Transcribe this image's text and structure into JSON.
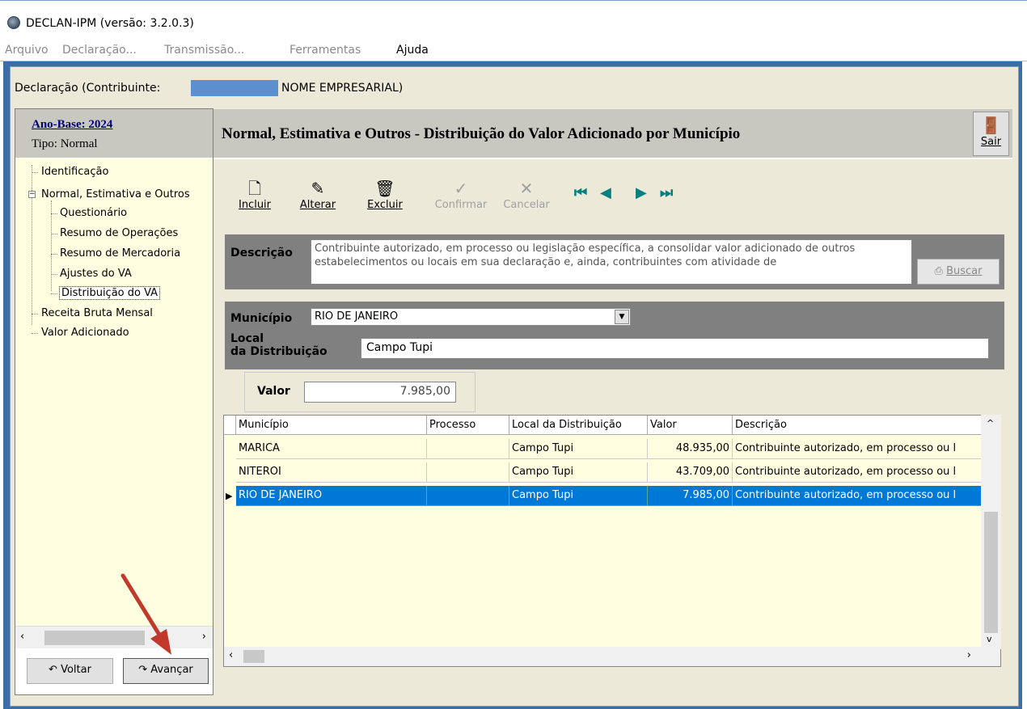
{
  "window": {
    "title": "DECLAN-IPM (versão: 3.2.0.3)"
  },
  "menu": {
    "items": [
      {
        "label": "Arquivo",
        "enabled": false
      },
      {
        "label": "Declaração...",
        "enabled": false
      },
      {
        "label": "Transmissão...",
        "enabled": false
      },
      {
        "label": "Ferramentas",
        "enabled": false
      },
      {
        "label": "Ajuda",
        "enabled": true
      }
    ]
  },
  "header": {
    "declaracao_prefix": "Declaração (Contribuinte:",
    "nome": "NOME EMPRESARIAL)"
  },
  "left": {
    "ano_base": "Ano-Base: 2024",
    "tipo": "Tipo: Normal",
    "tree": [
      "Identificação",
      "Normal, Estimativa e Outros",
      "Questionário",
      "Resumo de Operações",
      "Resumo de Mercadoria",
      "Ajustes do VA",
      "Distribuição do VA",
      "Receita Bruta Mensal",
      "Valor Adicionado"
    ],
    "voltar": "Voltar",
    "avancar": "Avançar"
  },
  "main": {
    "title": "Normal, Estimativa e Outros - Distribuição do Valor Adicionado por Município",
    "sair": "Sair",
    "toolbar": {
      "incluir": "Incluir",
      "alterar": "Alterar",
      "excluir": "Excluir",
      "confirmar": "Confirmar",
      "cancelar": "Cancelar"
    },
    "descricao_label": "Descrição",
    "descricao_text": "Contribuinte autorizado, em processo ou legislação específica, a consolidar valor adicionado de outros estabelecimentos ou locais em sua declaração e, ainda, contribuintes com atividade de",
    "buscar": "Buscar",
    "municipio_label": "Município",
    "municipio_value": "RIO DE JANEIRO",
    "local_label_1": "Local",
    "local_label_2": "da Distribuição",
    "local_value": "Campo Tupi",
    "valor_label": "Valor",
    "valor_value": "7.985,00"
  },
  "grid": {
    "columns": [
      "Município",
      "Processo",
      "Local da Distribuição",
      "Valor",
      "Descrição"
    ],
    "rows": [
      [
        "MARICA",
        "",
        "Campo Tupi",
        "48.935,00",
        "Contribuinte autorizado, em processo ou l"
      ],
      [
        "NITEROI",
        "",
        "Campo Tupi",
        "43.709,00",
        "Contribuinte autorizado, em processo ou l"
      ],
      [
        "RIO DE JANEIRO",
        "",
        "Campo Tupi",
        "7.985,00",
        "Contribuinte autorizado, em processo ou l"
      ]
    ],
    "selected_row": 2
  },
  "colors": {
    "selection": "#0078d7",
    "grid_bg": "#fefee0",
    "panel_gray": "#808080",
    "annotation_arrow": "#c0392b"
  }
}
